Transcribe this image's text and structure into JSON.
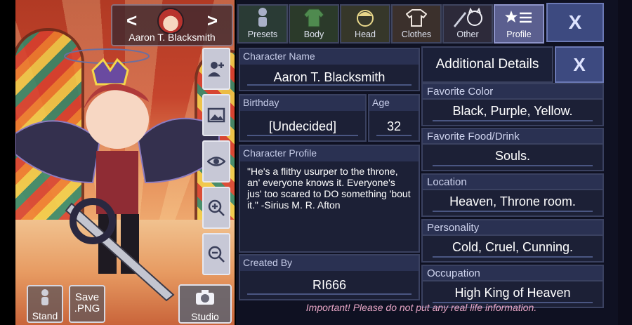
{
  "character": {
    "name": "Aaron T. Blacksmith"
  },
  "nav": {
    "prev": "<",
    "next": ">"
  },
  "tools": [
    "add-character",
    "background",
    "visibility",
    "zoom-in",
    "zoom-out"
  ],
  "bottom_buttons": {
    "stand": "Stand",
    "save_png_1": "Save",
    "save_png_2": ".PNG",
    "studio": "Studio"
  },
  "tabs": [
    {
      "label": "Presets"
    },
    {
      "label": "Body"
    },
    {
      "label": "Head"
    },
    {
      "label": "Clothes"
    },
    {
      "label": "Other"
    },
    {
      "label": "Profile"
    }
  ],
  "close_main": "X",
  "profile": {
    "name_label": "Character Name",
    "name_value": "Aaron T. Blacksmith",
    "birthday_label": "Birthday",
    "birthday_value": "[Undecided]",
    "age_label": "Age",
    "age_value": "32",
    "profile_label": "Character Profile",
    "profile_text": "\"He's a flithy usurper to the throne, an' everyone knows it. Everyone's jus' too scared to DO something 'bout it.\" -Sirius M. R. Afton",
    "created_label": "Created By",
    "created_value": "RI666"
  },
  "details": {
    "title": "Additional Details",
    "close": "X",
    "fields": [
      {
        "label": "Favorite Color",
        "value": "Black, Purple, Yellow."
      },
      {
        "label": "Favorite Food/Drink",
        "value": "Souls."
      },
      {
        "label": "Location",
        "value": "Heaven, Throne room."
      },
      {
        "label": "Personality",
        "value": "Cold, Cruel, Cunning."
      },
      {
        "label": "Occupation",
        "value": "High King of Heaven"
      }
    ]
  },
  "warning": "Important! Please do not put any real life information."
}
